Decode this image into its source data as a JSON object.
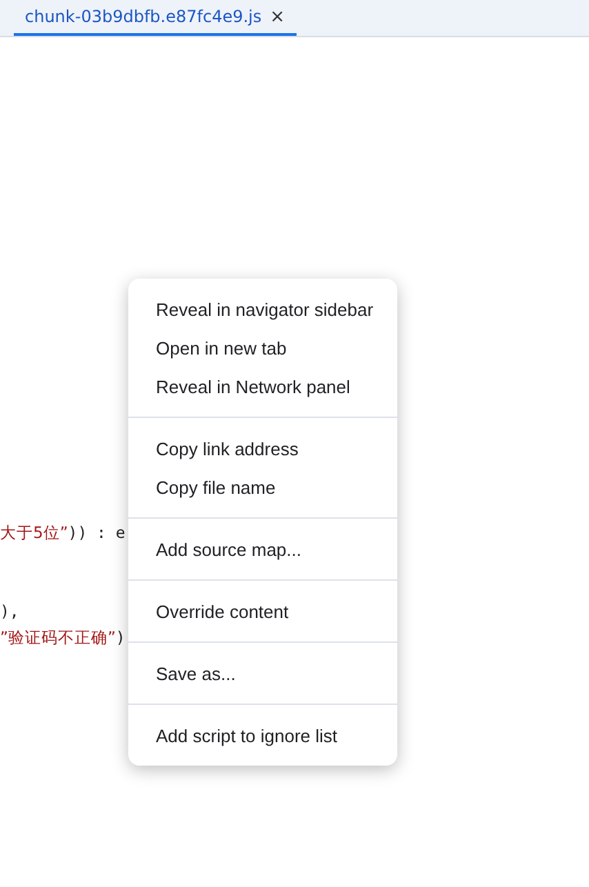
{
  "tabs": [
    {
      "label": "chunk-03b9dbfb.e87fc4e9.js",
      "selected": true,
      "close": "×"
    }
  ],
  "code_lines": [
    {
      "kind": "string",
      "text": "大于5位”",
      "rest": ")) : e"
    },
    {
      "kind": "blank"
    },
    {
      "kind": "blank"
    },
    {
      "kind": "plain",
      "text": "),"
    },
    {
      "kind": "string",
      "text": "”验证码不正确”",
      "rest": ")"
    }
  ],
  "context_menu": {
    "sections": [
      [
        "Reveal in navigator sidebar",
        "Open in new tab",
        "Reveal in Network panel"
      ],
      [
        "Copy link address",
        "Copy file name"
      ],
      [
        "Add source map..."
      ],
      [
        "Override content"
      ],
      [
        "Save as..."
      ],
      [
        "Add script to ignore list"
      ]
    ]
  }
}
